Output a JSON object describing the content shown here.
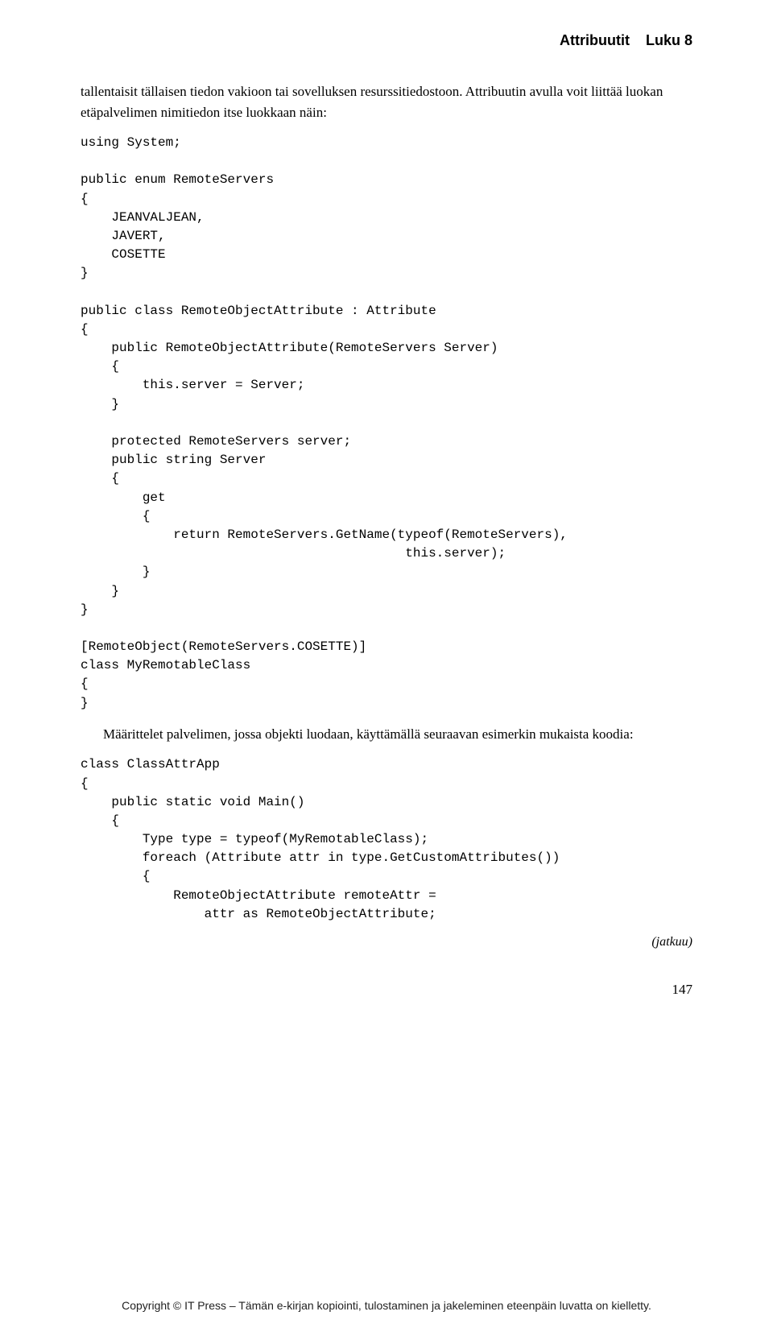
{
  "header": {
    "section": "Attribuutit",
    "chapter": "Luku 8"
  },
  "para1": "tallentaisit tällaisen tiedon vakioon tai sovelluksen resurssitiedostoon. Attribuutin avulla voit liittää luokan etäpalvelimen nimitiedon itse luokkaan näin:",
  "code1": "using System;\n\npublic enum RemoteServers\n{\n    JEANVALJEAN,\n    JAVERT,\n    COSETTE\n}\n\npublic class RemoteObjectAttribute : Attribute\n{\n    public RemoteObjectAttribute(RemoteServers Server)\n    {\n        this.server = Server;\n    }\n\n    protected RemoteServers server;\n    public string Server\n    {\n        get\n        {\n            return RemoteServers.GetName(typeof(RemoteServers),\n                                          this.server);\n        }\n    }\n}\n\n[RemoteObject(RemoteServers.COSETTE)]\nclass MyRemotableClass\n{\n}",
  "para2": "Määrittelet palvelimen, jossa objekti luodaan, käyttämällä seuraavan esimerkin mukaista koodia:",
  "code2": "class ClassAttrApp\n{\n    public static void Main()\n    {\n        Type type = typeof(MyRemotableClass);\n        foreach (Attribute attr in type.GetCustomAttributes())\n        {\n            RemoteObjectAttribute remoteAttr =\n                attr as RemoteObjectAttribute;",
  "continuation": "(jatkuu)",
  "pageNumber": "147",
  "footer": "Copyright © IT Press – Tämän e-kirjan kopiointi, tulostaminen ja jakeleminen eteenpäin luvatta on kielletty."
}
